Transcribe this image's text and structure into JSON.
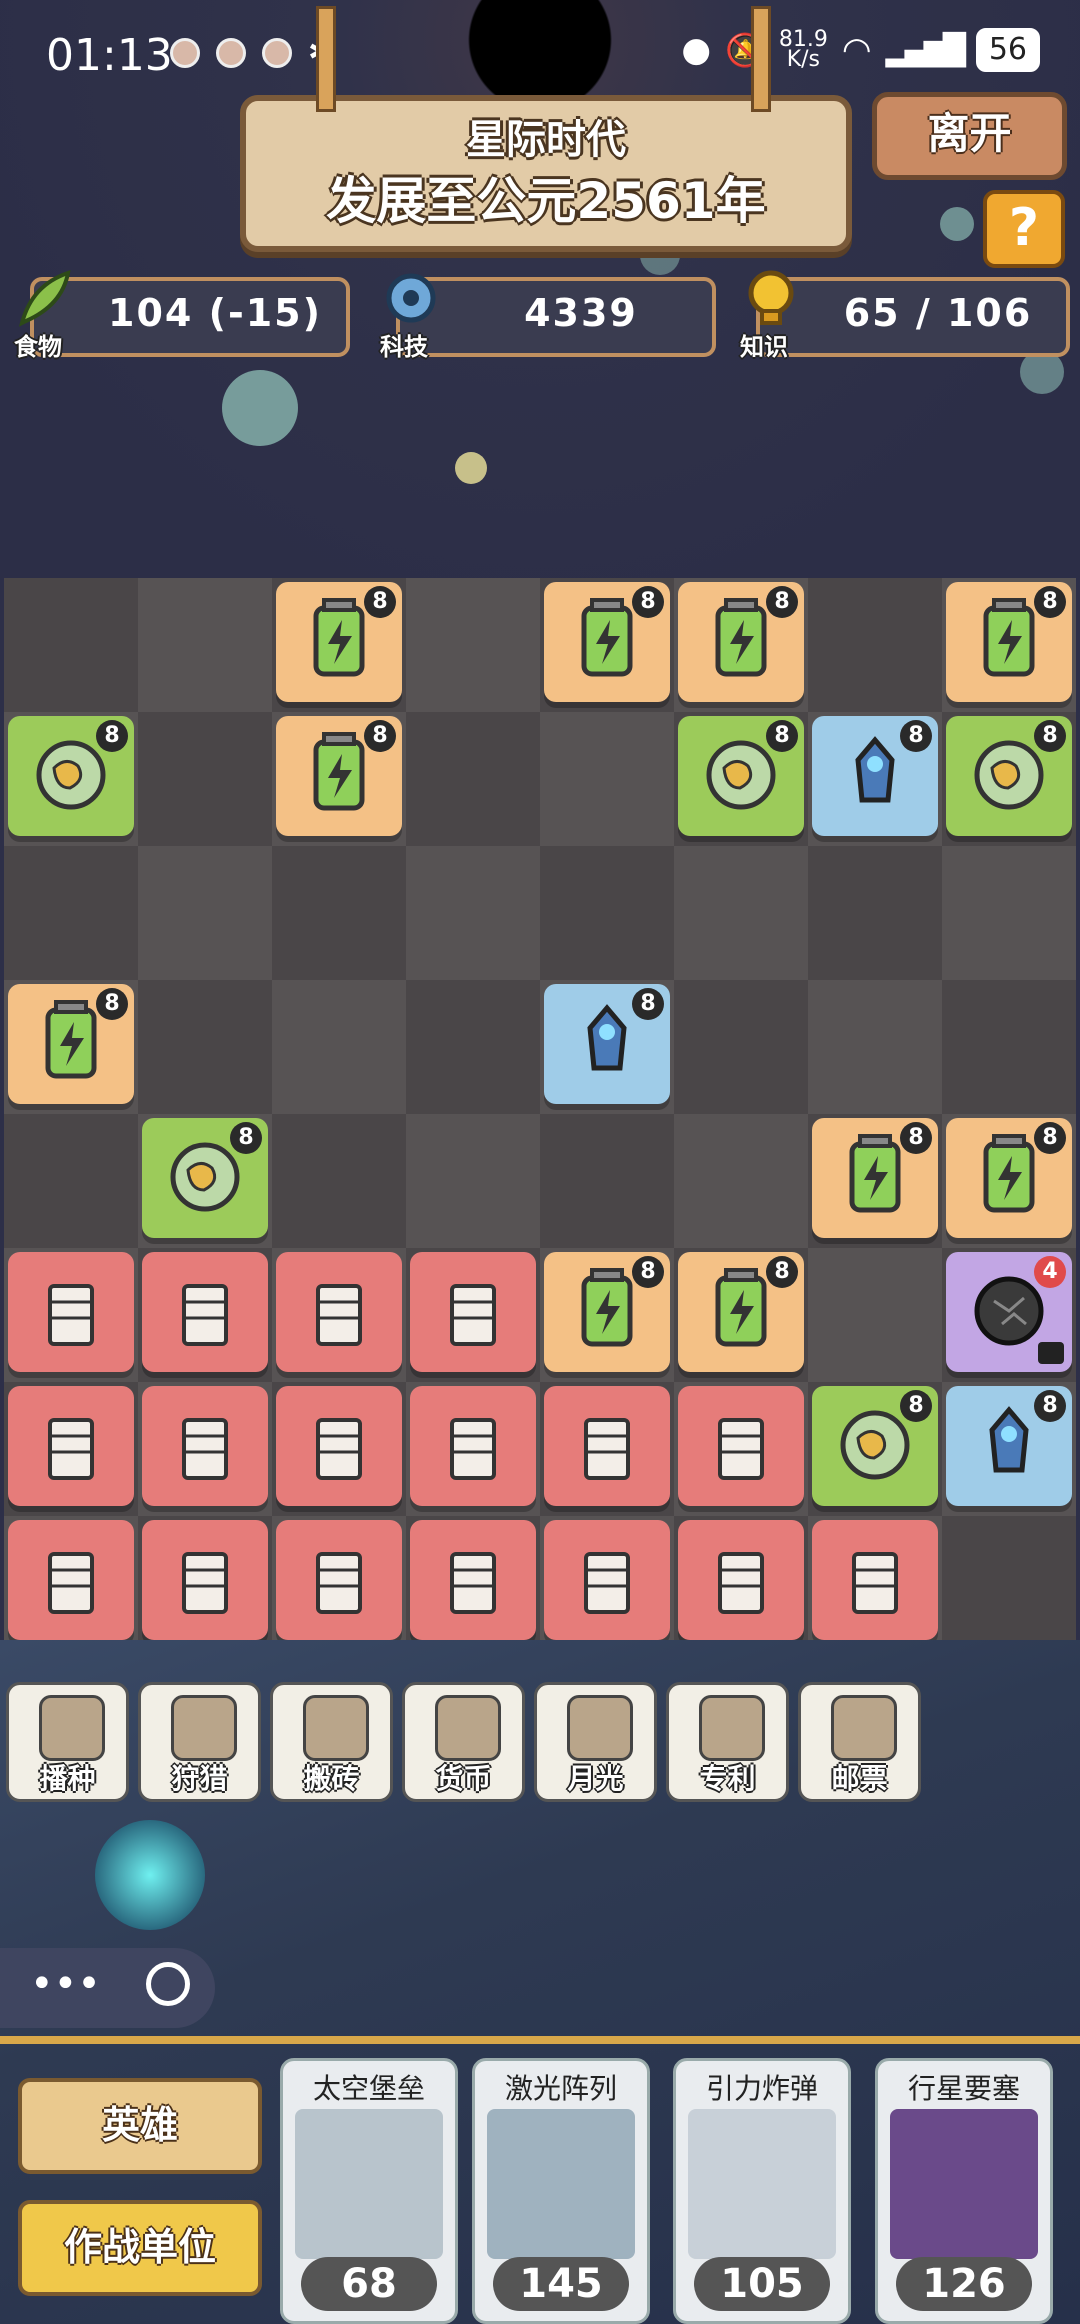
{
  "status_bar": {
    "time": "01:13",
    "network_speed": "81.9",
    "network_unit": "K/s",
    "battery": "56"
  },
  "header": {
    "era": "星际时代",
    "year_text": "发展至公元2561年",
    "leave_label": "离开",
    "help_label": "?"
  },
  "resources": {
    "food": {
      "label": "食物",
      "value": "104 (-15)"
    },
    "tech": {
      "label": "科技",
      "value": "4339"
    },
    "knowledge": {
      "label": "知识",
      "value": "65 / 106"
    }
  },
  "grid": {
    "columns": 8,
    "rows": 8,
    "cells": [
      {
        "col": 2,
        "row": 0,
        "type": "battery",
        "color": "orange",
        "badge": "8"
      },
      {
        "col": 4,
        "row": 0,
        "type": "battery",
        "color": "orange",
        "badge": "8"
      },
      {
        "col": 5,
        "row": 0,
        "type": "battery",
        "color": "orange",
        "badge": "8"
      },
      {
        "col": 7,
        "row": 0,
        "type": "battery",
        "color": "orange",
        "badge": "8"
      },
      {
        "col": 0,
        "row": 1,
        "type": "planet",
        "color": "green",
        "badge": "8"
      },
      {
        "col": 2,
        "row": 1,
        "type": "battery",
        "color": "orange",
        "badge": "8"
      },
      {
        "col": 5,
        "row": 1,
        "type": "planet",
        "color": "green",
        "badge": "8"
      },
      {
        "col": 6,
        "row": 1,
        "type": "mecha",
        "color": "blue",
        "badge": "8"
      },
      {
        "col": 7,
        "row": 1,
        "type": "planet",
        "color": "green",
        "badge": "8"
      },
      {
        "col": 0,
        "row": 3,
        "type": "battery",
        "color": "orange",
        "badge": "8"
      },
      {
        "col": 4,
        "row": 3,
        "type": "mecha",
        "color": "blue",
        "badge": "8"
      },
      {
        "col": 1,
        "row": 4,
        "type": "planet",
        "color": "green",
        "badge": "8"
      },
      {
        "col": 6,
        "row": 4,
        "type": "battery",
        "color": "orange",
        "badge": "8"
      },
      {
        "col": 7,
        "row": 4,
        "type": "battery",
        "color": "orange",
        "badge": "8"
      },
      {
        "col": 0,
        "row": 5,
        "type": "lighthouse",
        "color": "red",
        "badge": ""
      },
      {
        "col": 1,
        "row": 5,
        "type": "temple",
        "color": "red",
        "badge": ""
      },
      {
        "col": 2,
        "row": 5,
        "type": "terracotta",
        "color": "red",
        "badge": ""
      },
      {
        "col": 3,
        "row": 5,
        "type": "great-wall",
        "color": "red",
        "badge": ""
      },
      {
        "col": 4,
        "row": 5,
        "type": "battery",
        "color": "orange",
        "badge": "8"
      },
      {
        "col": 5,
        "row": 5,
        "type": "battery",
        "color": "orange",
        "badge": "8"
      },
      {
        "col": 7,
        "row": 5,
        "type": "asteroid",
        "color": "purple",
        "badge": "4",
        "locked": true
      },
      {
        "col": 0,
        "row": 6,
        "type": "statue",
        "color": "red",
        "badge": ""
      },
      {
        "col": 1,
        "row": 6,
        "type": "pyramid",
        "color": "red",
        "badge": ""
      },
      {
        "col": 2,
        "row": 6,
        "type": "angkor",
        "color": "red",
        "badge": ""
      },
      {
        "col": 3,
        "row": 6,
        "type": "liberty",
        "color": "red",
        "badge": ""
      },
      {
        "col": 4,
        "row": 6,
        "type": "mayan-pyramid",
        "color": "red",
        "badge": ""
      },
      {
        "col": 5,
        "row": 6,
        "type": "palace",
        "color": "red",
        "badge": ""
      },
      {
        "col": 6,
        "row": 6,
        "type": "planet",
        "color": "green",
        "badge": "8"
      },
      {
        "col": 7,
        "row": 6,
        "type": "mecha",
        "color": "blue",
        "badge": "8"
      },
      {
        "col": 0,
        "row": 7,
        "type": "zeus",
        "color": "red",
        "badge": ""
      },
      {
        "col": 1,
        "row": 7,
        "type": "hanging-garden",
        "color": "red",
        "badge": ""
      },
      {
        "col": 2,
        "row": 7,
        "type": "pisa",
        "color": "red",
        "badge": ""
      },
      {
        "col": 3,
        "row": 7,
        "type": "taj-mahal",
        "color": "red",
        "badge": ""
      },
      {
        "col": 4,
        "row": 7,
        "type": "colosseum",
        "color": "red",
        "badge": ""
      },
      {
        "col": 5,
        "row": 7,
        "type": "eiffel",
        "color": "red",
        "badge": ""
      },
      {
        "col": 6,
        "row": 7,
        "type": "machu-picchu",
        "color": "red",
        "badge": ""
      }
    ]
  },
  "toolbar": [
    {
      "label": "播种",
      "icon": "seed-icon"
    },
    {
      "label": "狩猎",
      "icon": "hunter-icon"
    },
    {
      "label": "搬砖",
      "icon": "brick-icon"
    },
    {
      "label": "货币",
      "icon": "coin-icon"
    },
    {
      "label": "月光",
      "icon": "moonlight-icon"
    },
    {
      "label": "专利",
      "icon": "patent-icon"
    },
    {
      "label": "邮票",
      "icon": "stamp-icon"
    }
  ],
  "bottom": {
    "hero_label": "英雄",
    "units_label": "作战单位",
    "cards": [
      {
        "name": "太空堡垒",
        "cost": "68"
      },
      {
        "name": "激光阵列",
        "cost": "145"
      },
      {
        "name": "引力炸弹",
        "cost": "105"
      },
      {
        "name": "行星要塞",
        "cost": "126"
      }
    ]
  },
  "colors": {
    "orange": "#f4c186",
    "green": "#9ccb5a",
    "blue": "#9fcce8",
    "red": "#e67c7a",
    "purple": "#c2a6e4",
    "board_dark": "#4a4648",
    "board_light": "#575354"
  }
}
